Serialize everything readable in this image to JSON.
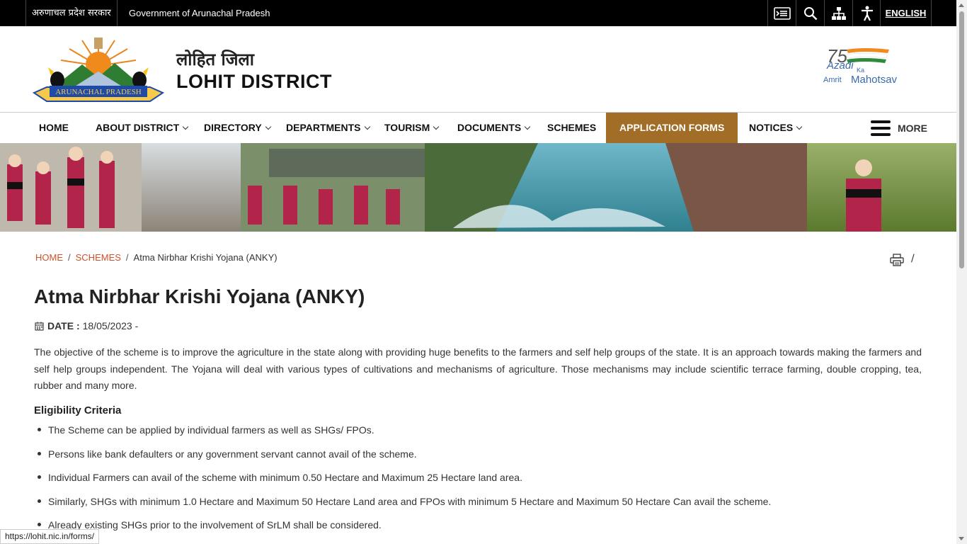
{
  "topbar": {
    "gov_hindi": "अरुणाचल प्रदेश सरकार",
    "gov_english": "Government of Arunachal Pradesh",
    "tools": [
      "skip-to-content-icon",
      "search-icon",
      "sitemap-icon",
      "accessibility-icon"
    ],
    "language": "ENGLISH"
  },
  "header": {
    "emblem_text": "ARUNACHAL PRADESH",
    "district_hindi": "लोहित जिला",
    "district_english": "LOHIT DISTRICT",
    "azadi": {
      "azadi": "Azadi",
      "ka": "Ka",
      "amrit": "Amrit",
      "mahotsav": "Mahotsav",
      "number": "75"
    }
  },
  "nav": {
    "items": [
      {
        "label": "HOME",
        "dropdown": false
      },
      {
        "label": "ABOUT DISTRICT",
        "dropdown": true
      },
      {
        "label": "DIRECTORY",
        "dropdown": true
      },
      {
        "label": "DEPARTMENTS",
        "dropdown": true
      },
      {
        "label": "TOURISM",
        "dropdown": true
      },
      {
        "label": "DOCUMENTS",
        "dropdown": true
      },
      {
        "label": "SCHEMES",
        "dropdown": false
      },
      {
        "label": "APPLICATION FORMS",
        "dropdown": false,
        "active": true
      },
      {
        "label": "NOTICES",
        "dropdown": true
      }
    ],
    "more": "MORE"
  },
  "breadcrumb": {
    "home": "HOME",
    "schemes": "SCHEMES",
    "current": "Atma Nirbhar Krishi Yojana (ANKY)",
    "separator": "/"
  },
  "content": {
    "title": "Atma Nirbhar Krishi Yojana (ANKY)",
    "date_label": "DATE :",
    "date_value": "18/05/2023 -",
    "intro": "The objective of the scheme is to improve the agriculture in the state along with providing huge benefits to the farmers and self help groups of the state. It is an approach towards making the farmers and self help groups independent. The Yojana will deal with various types of cultivations and mechanisms of agriculture. Those mechanisms may include scientific terrace farming, double cropping, tea, rubber and many more.",
    "eligibility_heading": "Eligibility Criteria",
    "eligibility": [
      "The Scheme can be applied by individual farmers as well as SHGs/ FPOs.",
      "Persons like bank defaulters or any government servant cannot avail of the scheme.",
      "Individual Farmers can avail of the scheme with minimum 0.50 Hectare and Maximum 25 Hectare land area.",
      "Similarly, SHGs with minimum 1.0 Hectare and Maximum 50 Hectare Land area and FPOs with minimum 5 Hectare and Maximum 50 Hectare Can avail the scheme.",
      "Already existing SHGs prior to the involvement of SrLM shall be considered."
    ]
  },
  "status_url": "https://lohit.nic.in/forms/",
  "colors": {
    "accent": "#a26d26",
    "link": "#d0502a",
    "topbar": "#000000"
  }
}
